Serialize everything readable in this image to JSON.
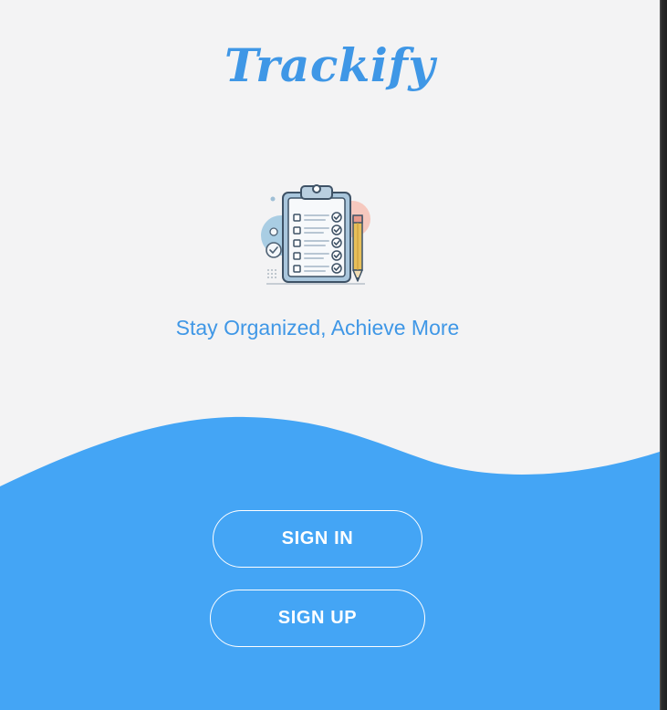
{
  "app": {
    "title": "Trackify",
    "tagline": "Stay Organized, Achieve More"
  },
  "logo": {
    "icon": "clipboard-checklist-icon"
  },
  "actions": {
    "sign_in_label": "SIGN IN",
    "sign_up_label": "SIGN UP"
  },
  "colors": {
    "background": "#f3f3f4",
    "accent": "#3f97e6",
    "wave": "#44a5f5",
    "button_text": "#ffffff"
  }
}
